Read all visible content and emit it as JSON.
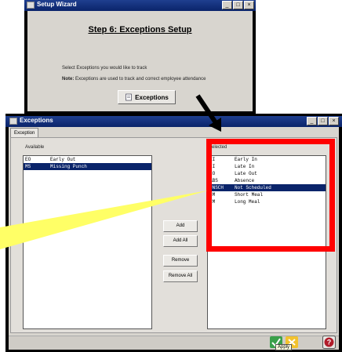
{
  "colors": {
    "titlebar": "#0a246a",
    "selection": "#0a246a",
    "highlight": "#ff0000",
    "callout": "#ffff66"
  },
  "wizard": {
    "title": "Setup Wizard",
    "controls": [
      "_",
      "□",
      "×"
    ],
    "heading": "Step 6: Exceptions Setup",
    "prompt": "Select Exceptions you would like to track",
    "note_label": "Note:",
    "note_text": "Exceptions are used to track and correct employee attendance",
    "exceptions_button": "Exceptions",
    "exceptions_icon": "document-icon"
  },
  "exceptions_window": {
    "title": "Exceptions",
    "controls": [
      "_",
      "□",
      "×"
    ],
    "tab": "Exception",
    "available_label": "Available",
    "selected_label": "Selected",
    "available": [
      {
        "code": "EO",
        "name": "Early Out"
      },
      {
        "code": "MS",
        "name": "Missing Punch"
      }
    ],
    "available_selected_index": 1,
    "selected": [
      {
        "code": "EI",
        "name": "Early In"
      },
      {
        "code": "LI",
        "name": "Late In"
      },
      {
        "code": "LO",
        "name": "Late Out"
      },
      {
        "code": "ABS",
        "name": "Absence"
      },
      {
        "code": "UNSCH",
        "name": "Not Scheduled"
      },
      {
        "code": "SM",
        "name": "Short Meal"
      },
      {
        "code": "LM",
        "name": "Long Meal"
      }
    ],
    "selected_selected_index": 4,
    "buttons": {
      "add": "Add",
      "add_all": "Add All",
      "remove": "Remove",
      "remove_all": "Remove All"
    },
    "apply_tooltip": "Apply",
    "footer_icons": [
      "apply-check-icon",
      "cancel-icon",
      "help-icon"
    ]
  }
}
